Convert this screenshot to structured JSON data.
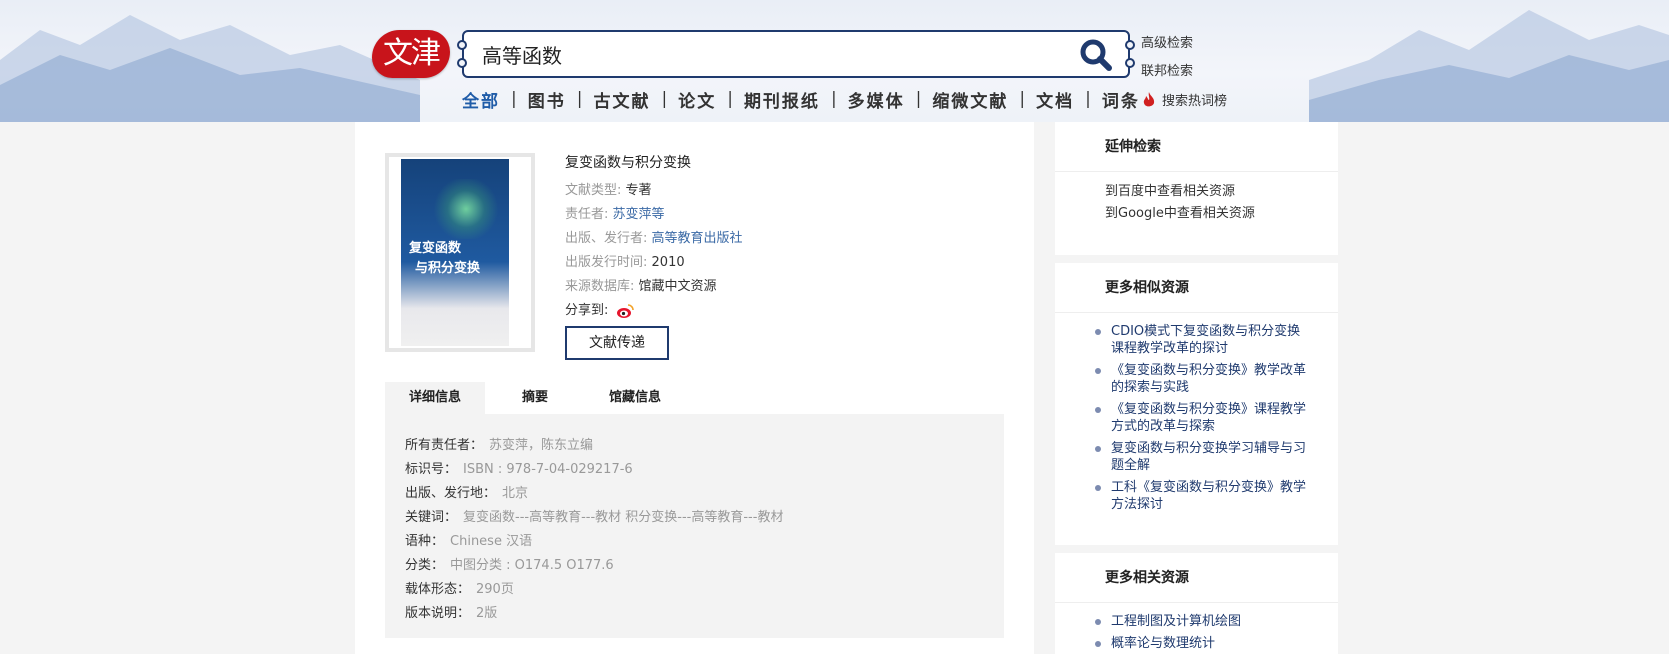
{
  "header": {
    "logo_text": "文津",
    "search_value": "高等函数",
    "advanced_search": "高级检索",
    "federated_search": "联邦检索",
    "hot_search": "搜索热词榜",
    "nav": [
      "全部",
      "图书",
      "古文献",
      "论文",
      "期刊报纸",
      "多媒体",
      "缩微文献",
      "文档",
      "词条"
    ],
    "nav_active": "全部",
    "accent_color": "#1f3a6e",
    "logo_color": "#c8141b"
  },
  "book": {
    "cover_title_line1": "复变函数",
    "cover_title_line2": "与积分变换",
    "title": "复变函数与积分变换",
    "doc_type_label": "文献类型:",
    "doc_type": "专著",
    "author_label": "责任者:",
    "author": "苏变萍等",
    "publisher_label": "出版、发行者:",
    "publisher": "高等教育出版社",
    "date_label": "出版发行时间:",
    "date": "2010",
    "source_label": "来源数据库:",
    "source": "馆藏中文资源",
    "share_label": "分享到:",
    "deliver_button": "文献传递"
  },
  "tabs": [
    "详细信息",
    "摘要",
    "馆藏信息"
  ],
  "details": [
    {
      "label": "所有责任者：",
      "value": "苏变萍，陈东立编"
    },
    {
      "label": "标识号：",
      "value": "ISBN : 978-7-04-029217-6"
    },
    {
      "label": "出版、发行地：",
      "value": "北京"
    },
    {
      "label": "关键词：",
      "value": "复变函数---高等教育---教材  积分变换---高等教育---教材"
    },
    {
      "label": "语种：",
      "value": "Chinese 汉语"
    },
    {
      "label": "分类：",
      "value": "中图分类 : O174.5  O177.6"
    },
    {
      "label": "载体形态：",
      "value": "290页"
    },
    {
      "label": "版本说明：",
      "value": "2版"
    }
  ],
  "sidebar": {
    "extend": {
      "title": "延伸检索",
      "links": [
        "到百度中查看相关资源",
        "到Google中查看相关资源"
      ]
    },
    "similar": {
      "title": "更多相似资源",
      "items": [
        "CDIO模式下复变函数与积分变换课程教学改革的探讨",
        "《复变函数与积分变换》教学改革的探索与实践",
        "《复变函数与积分变换》课程教学方式的改革与探索",
        "复变函数与积分变换学习辅导与习题全解",
        "工科《复变函数与积分变换》教学方法探讨"
      ]
    },
    "related": {
      "title": "更多相关资源",
      "items": [
        "工程制图及计算机绘图",
        "概率论与数理统计"
      ]
    }
  }
}
